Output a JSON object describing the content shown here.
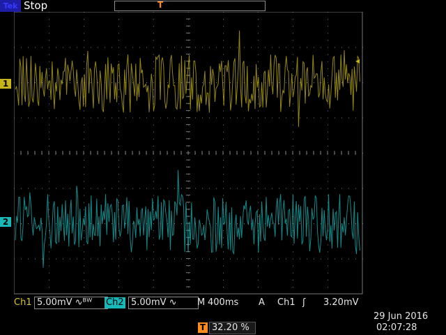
{
  "header": {
    "brand": "Tek",
    "status": "Stop",
    "trigger_position_marker": "T"
  },
  "channel_markers": {
    "ch1": "1",
    "ch2": "2",
    "trigger": "T"
  },
  "status_bar": {
    "ch1_label": "Ch1",
    "ch1_scale": "5.00mV",
    "ch2_label": "Ch2",
    "ch2_scale": "5.00mV",
    "timebase_prefix": "M",
    "timebase": "400ms",
    "trigger_mode": "A",
    "trigger_source": "Ch1",
    "trigger_level": "3.20mV",
    "trigger_position_value": "32.20 %",
    "date": "29 Jun  2016",
    "time": "02:07:28"
  },
  "colors": {
    "ch1": "#c6b419",
    "ch2": "#19b8b8",
    "trigger": "#ff8c1a",
    "grid": "#7a7a7a"
  }
}
